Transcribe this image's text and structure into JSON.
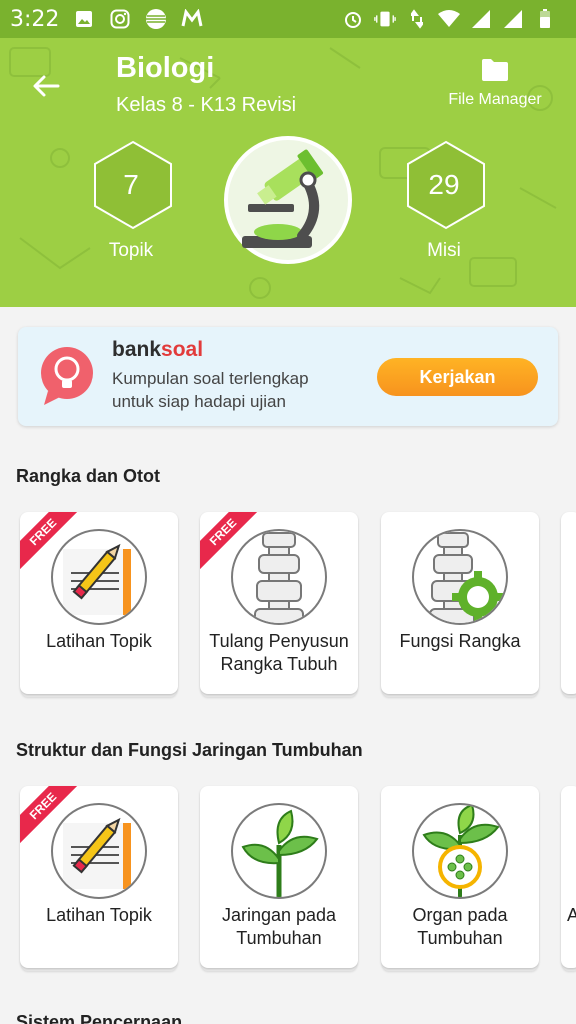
{
  "status_bar": {
    "time": "3:22"
  },
  "header": {
    "title": "Biologi",
    "subtitle": "Kelas 8 - K13 Revisi",
    "file_manager_label": "File Manager",
    "topik": {
      "value": "7",
      "label": "Topik"
    },
    "misi": {
      "value": "29",
      "label": "Misi"
    }
  },
  "banksoal": {
    "title_part1": "bank",
    "title_part2": "soal",
    "description": "Kumpulan soal terlengkap untuk siap hadapi ujian",
    "button_label": "Kerjakan"
  },
  "sections": [
    {
      "title": "Rangka dan Otot",
      "cards": [
        {
          "label": "Latihan Topik",
          "badge": "FREE",
          "icon": "pencil-paper-icon"
        },
        {
          "label": "Tulang Penyusun Rangka Tubuh",
          "badge": "FREE",
          "icon": "spine-icon"
        },
        {
          "label": "Fungsi Rangka",
          "icon": "spine-gear-icon"
        }
      ]
    },
    {
      "title": "Struktur dan Fungsi Jaringan Tumbuhan",
      "cards": [
        {
          "label": "Latihan Topik",
          "badge": "FREE",
          "icon": "pencil-paper-icon"
        },
        {
          "label": "Jaringan pada Tumbuhan",
          "icon": "sprout-icon"
        },
        {
          "label": "Organ pada Tumbuhan",
          "icon": "sprout-cell-icon"
        },
        {
          "label": "A"
        }
      ]
    },
    {
      "title": "Sistem Pencernaan"
    }
  ],
  "colors": {
    "status_bar": "#7ab22e",
    "header": "#9dcf44",
    "free_ribbon": "#e8284b",
    "button": "#f7931e",
    "bank_bg": "#e6f4fb"
  }
}
